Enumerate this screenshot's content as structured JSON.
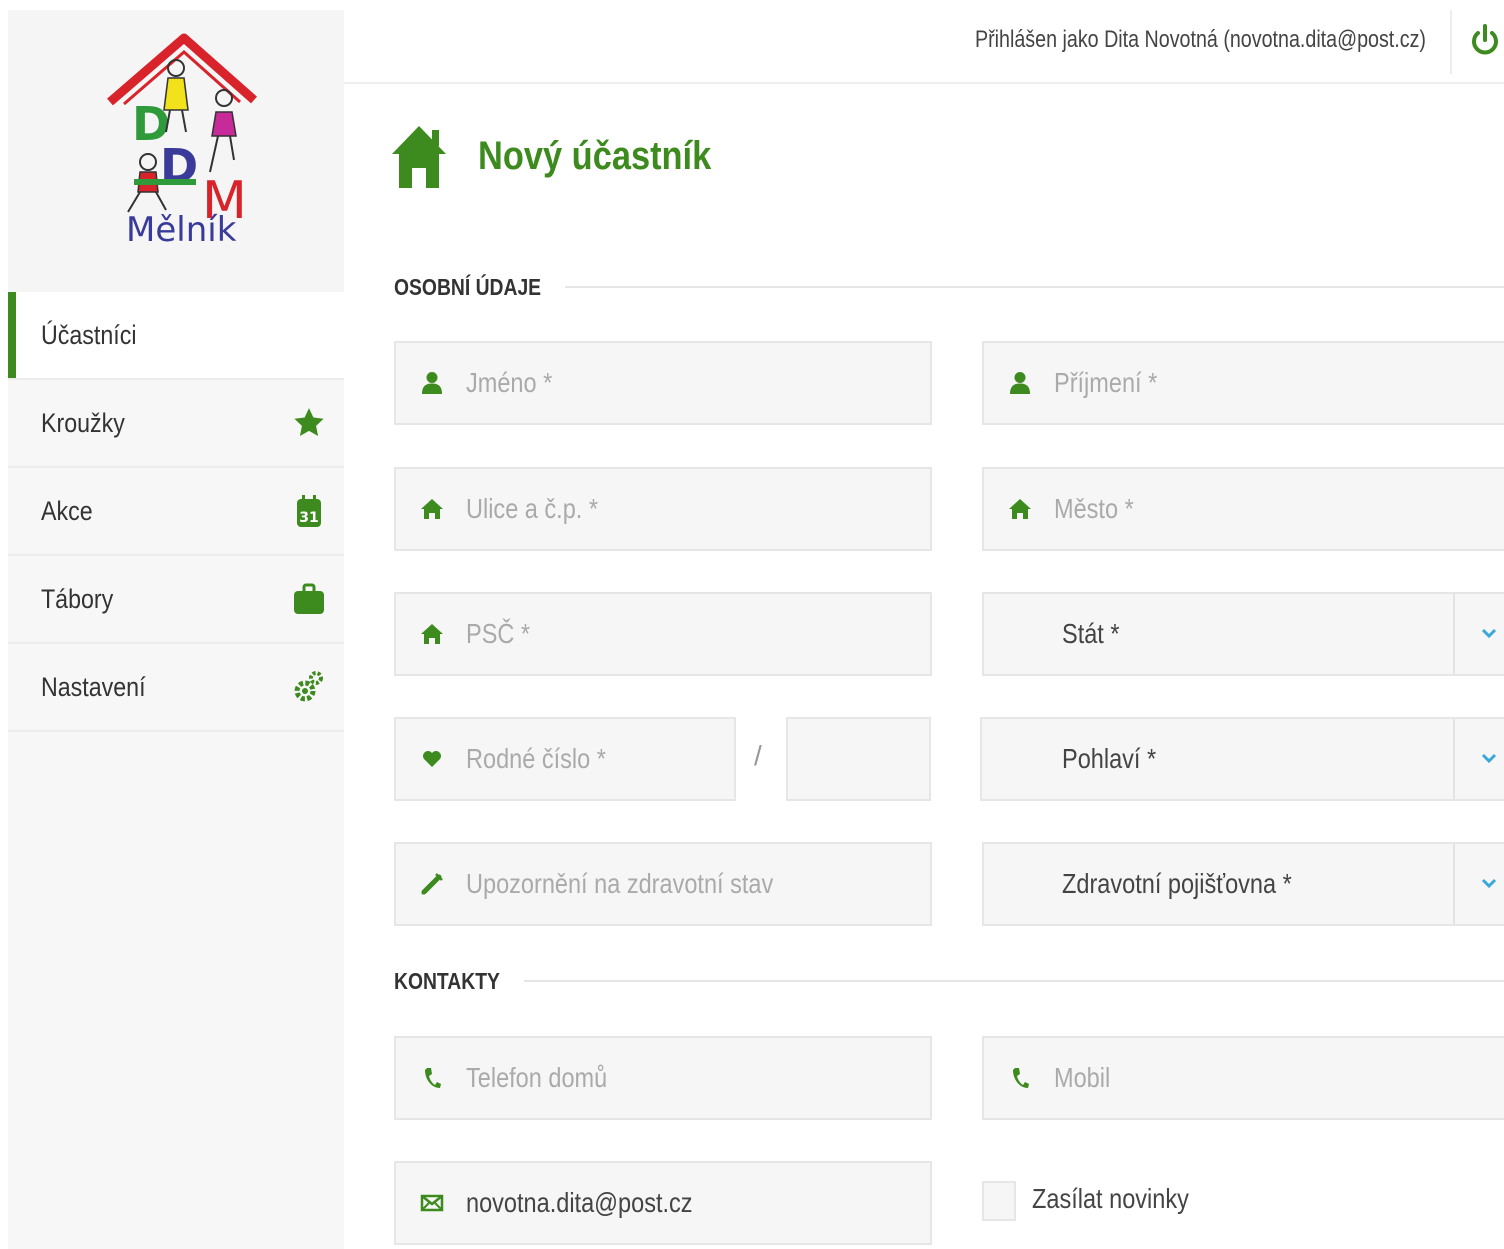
{
  "logo": {
    "caption": "Mělník",
    "letters": [
      "D",
      "D",
      "M"
    ]
  },
  "nav": {
    "items": [
      {
        "label": "Účastníci",
        "icon": "",
        "active": true
      },
      {
        "label": "Kroužky",
        "icon": "star-icon"
      },
      {
        "label": "Akce",
        "icon": "calendar-icon",
        "badge": "31"
      },
      {
        "label": "Tábory",
        "icon": "briefcase-icon"
      },
      {
        "label": "Nastavení",
        "icon": "gears-icon"
      }
    ]
  },
  "header": {
    "user_info": "Přihlášen jako Dita Novotná (novotna.dita@post.cz)",
    "logout_icon": "power-icon"
  },
  "page": {
    "title": "Nový účastník",
    "title_icon": "home-icon"
  },
  "sections": {
    "personal": "OSOBNÍ ÚDAJE",
    "contacts": "KONTAKTY"
  },
  "form": {
    "first_name": {
      "placeholder": "Jméno *",
      "icon": "user-icon"
    },
    "last_name": {
      "placeholder": "Příjmení *",
      "icon": "user-icon"
    },
    "street": {
      "placeholder": "Ulice a č.p. *",
      "icon": "home-icon"
    },
    "city": {
      "placeholder": "Město *",
      "icon": "home-icon"
    },
    "zip": {
      "placeholder": "PSČ *",
      "icon": "home-icon"
    },
    "country": {
      "value": "Stát *",
      "icon": "chevron-down-icon"
    },
    "birth_number": {
      "placeholder": "Rodné číslo *",
      "separator": "/",
      "suffix": "",
      "icon": "heart-icon"
    },
    "gender": {
      "value": "Pohlaví *",
      "icon": "chevron-down-icon"
    },
    "health_note": {
      "placeholder": "Upozornění na zdravotní stav",
      "icon": "syringe-icon"
    },
    "insurance": {
      "value": "Zdravotní pojišťovna *",
      "icon": "chevron-down-icon"
    },
    "home_phone": {
      "placeholder": "Telefon domů",
      "icon": "phone-icon"
    },
    "mobile": {
      "placeholder": "Mobil",
      "icon": "phone-icon"
    },
    "email": {
      "value": "novotna.dita@post.cz",
      "icon": "envelope-icon"
    },
    "newsletter": {
      "label": "Zasílat novinky",
      "checked": false
    }
  },
  "colors": {
    "accent": "#3d8b1e",
    "field_bg": "#f6f6f6",
    "sidebar_bg": "#f7f7f7"
  }
}
